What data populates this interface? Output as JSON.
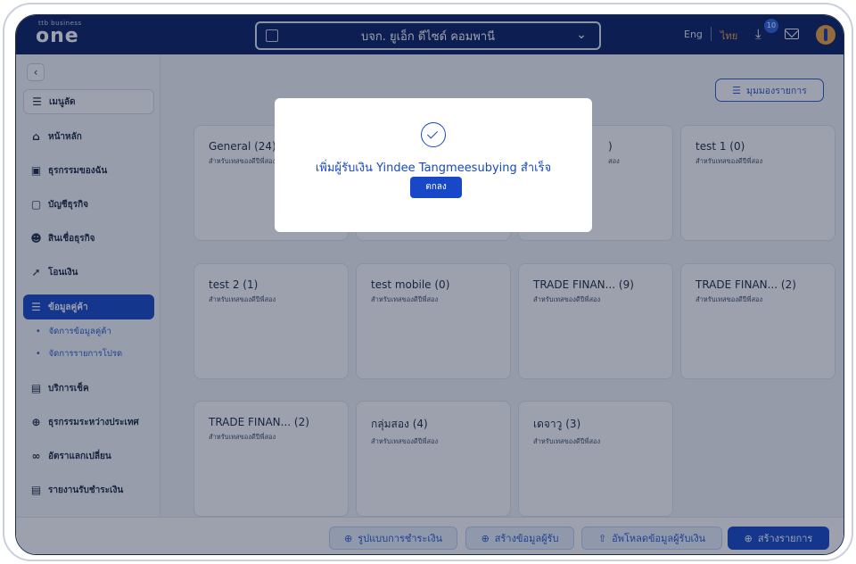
{
  "header": {
    "logo_small": "ttb business",
    "logo_big": "one",
    "company_name": "บจก. ยูเอ็ก ดีไซด์ คอมพานี",
    "lang_en": "Eng",
    "lang_th": "ไทย",
    "notification_count": "10"
  },
  "sidebar": {
    "items": [
      {
        "label": "เมนูลัด",
        "icon": "favorites-icon"
      },
      {
        "label": "หน้าหลัก",
        "icon": "home-icon"
      },
      {
        "label": "ธุรกรรมของฉัน",
        "icon": "briefcase-icon"
      },
      {
        "label": "บัญชีธุรกิจ",
        "icon": "wallet-icon"
      },
      {
        "label": "สินเชื่อธุรกิจ",
        "icon": "loan-icon"
      },
      {
        "label": "โอนเงิน",
        "icon": "transfer-icon"
      },
      {
        "label": "ข้อมูลคู่ค้า",
        "icon": "partner-icon"
      },
      {
        "label": "บริการเช็ค",
        "icon": "cheque-icon"
      },
      {
        "label": "ธุรกรรมระหว่างประเทศ",
        "icon": "globe-icon"
      },
      {
        "label": "อัตราแลกเปลี่ยน",
        "icon": "exchange-icon"
      },
      {
        "label": "รายงานรับชำระเงิน",
        "icon": "report-icon"
      }
    ],
    "sub_items": [
      "จัดการข้อมูลคู่ค้า",
      "จัดการรายการโปรด"
    ]
  },
  "main": {
    "view_button": "มุมมองรายการ",
    "cards": [
      {
        "title": "General (24)",
        "subtitle": "สำหรับเทสของดีปีพี่สอง"
      },
      {
        "title": "",
        "subtitle": ""
      },
      {
        "title": ")",
        "subtitle": "สอง"
      },
      {
        "title": "test 1 (0)",
        "subtitle": "สำหรับเทสของดีปีพี่สอง"
      },
      {
        "title": "test 2 (1)",
        "subtitle": "สำหรับเทสของดีปีพี่สอง"
      },
      {
        "title": "test mobile (0)",
        "subtitle": "สำหรับเทสของดีปีพี่สอง"
      },
      {
        "title": "TRADE FINAN...  (9)",
        "subtitle": "สำหรับเทสของดีปีพี่สอง"
      },
      {
        "title": "TRADE FINAN...  (2)",
        "subtitle": "สำหรับเทสของดีปีพี่สอง"
      },
      {
        "title": "TRADE FINAN...  (2)",
        "subtitle": "สำหรับเทสของดีปีพี่สอง"
      },
      {
        "title": "กลุ่มสอง (4)",
        "subtitle": "สำหรับเทสของดีปีพี่สอง"
      },
      {
        "title": "เดจาวู (3)",
        "subtitle": "สำหรับเทสของดีปีพี่สอง"
      }
    ]
  },
  "footer": {
    "payment_format": "รูปแบบการชำระเงิน",
    "create_payee": "สร้างข้อมูลผู้รับ",
    "upload_payee": "อัพโหลดข้อมูลผู้รับเงิน",
    "create_transaction": "สร้างรายการ"
  },
  "modal": {
    "message": "เพิ่มผู้รับเงิน Yindee Tangmeesubying สำเร็จ",
    "ok": "ตกลง"
  },
  "colors": {
    "header_bg": "#0a1f63",
    "accent": "#1848c8",
    "lang_active": "#f2a23a"
  }
}
